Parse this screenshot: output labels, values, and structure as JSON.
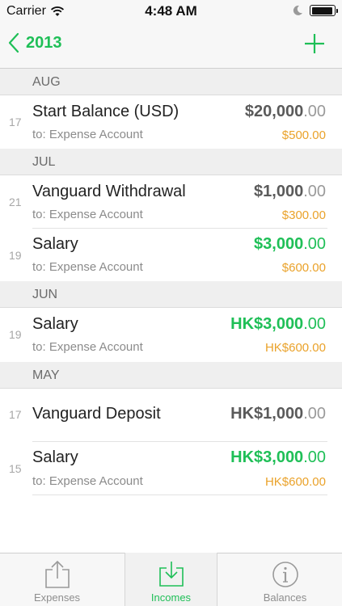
{
  "status_bar": {
    "carrier": "Carrier",
    "time": "4:48 AM",
    "battery_level": 0.95
  },
  "nav": {
    "back_label": "2013",
    "back_icon": "chevron-left-icon",
    "add_icon": "plus-icon"
  },
  "sections": [
    {
      "month": "AUG",
      "rows": [
        {
          "day": "17",
          "title": "Start Balance (USD)",
          "subtitle": "to: Expense Account",
          "amount_main": "$20,000",
          "amount_cents": ".00",
          "amount_style": "gray",
          "secondary": "$500.00"
        }
      ]
    },
    {
      "month": "JUL",
      "rows": [
        {
          "day": "21",
          "title": "Vanguard Withdrawal",
          "subtitle": "to: Expense Account",
          "amount_main": "$1,000",
          "amount_cents": ".00",
          "amount_style": "gray",
          "secondary": "$300.00"
        },
        {
          "day": "19",
          "title": "Salary",
          "subtitle": "to: Expense Account",
          "amount_main": "$3,000",
          "amount_cents": ".00",
          "amount_style": "green",
          "secondary": "$600.00"
        }
      ]
    },
    {
      "month": "JUN",
      "rows": [
        {
          "day": "19",
          "title": "Salary",
          "subtitle": "to: Expense Account",
          "amount_main": "HK$3,000",
          "amount_cents": ".00",
          "amount_style": "green",
          "secondary": "HK$600.00"
        }
      ]
    },
    {
      "month": "MAY",
      "rows": [
        {
          "day": "17",
          "title": "Vanguard Deposit",
          "subtitle": "",
          "amount_main": "HK$1,000",
          "amount_cents": ".00",
          "amount_style": "gray",
          "secondary": ""
        },
        {
          "day": "15",
          "title": "Salary",
          "subtitle": "to: Expense Account",
          "amount_main": "HK$3,000",
          "amount_cents": ".00",
          "amount_style": "green",
          "secondary": "HK$600.00"
        }
      ]
    }
  ],
  "tabs": [
    {
      "label": "Expenses",
      "icon": "share-out-icon",
      "active": false
    },
    {
      "label": "Incomes",
      "icon": "download-tray-icon",
      "active": true
    },
    {
      "label": "Balances",
      "icon": "info-icon",
      "active": false
    }
  ],
  "colors": {
    "accent": "#1fbf57",
    "secondary_amount": "#eaa22a",
    "section_bg": "#efefef"
  }
}
